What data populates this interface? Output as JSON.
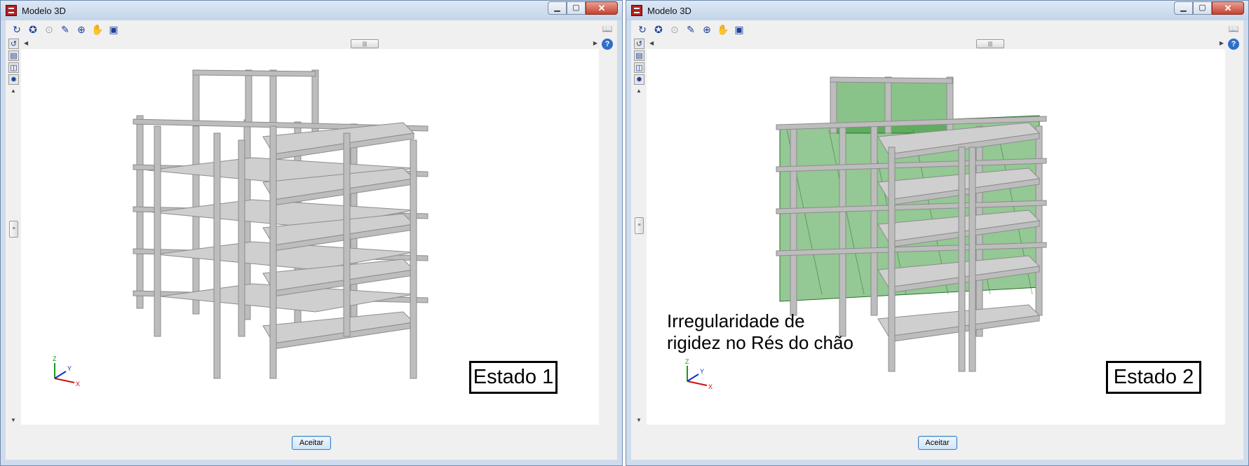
{
  "windows": [
    {
      "title": "Modelo 3D",
      "accept_label": "Aceitar",
      "state_label": "Estado 1"
    },
    {
      "title": "Modelo 3D",
      "accept_label": "Aceitar",
      "state_label": "Estado 2",
      "annotation": "Irregularidade de\nrigidez no Rés do chão"
    }
  ],
  "caption_buttons": {
    "min": "▁",
    "max": "▢",
    "close": "✕"
  },
  "toolbar_icons": [
    "rotate-icon",
    "orbit-icon",
    "zoom-disabled-icon",
    "pencil-icon",
    "zoom-window-icon",
    "pan-hand-icon",
    "view-layers-icon"
  ],
  "axis_labels": {
    "x": "X",
    "y": "Y",
    "z": "Z"
  },
  "colors": {
    "concrete": "#bdbdbd",
    "concrete_dark": "#8c8c8c",
    "slab_top": "#cfcfcf",
    "wall_green": "#3c9b3c",
    "title_close": "#c4432f"
  }
}
